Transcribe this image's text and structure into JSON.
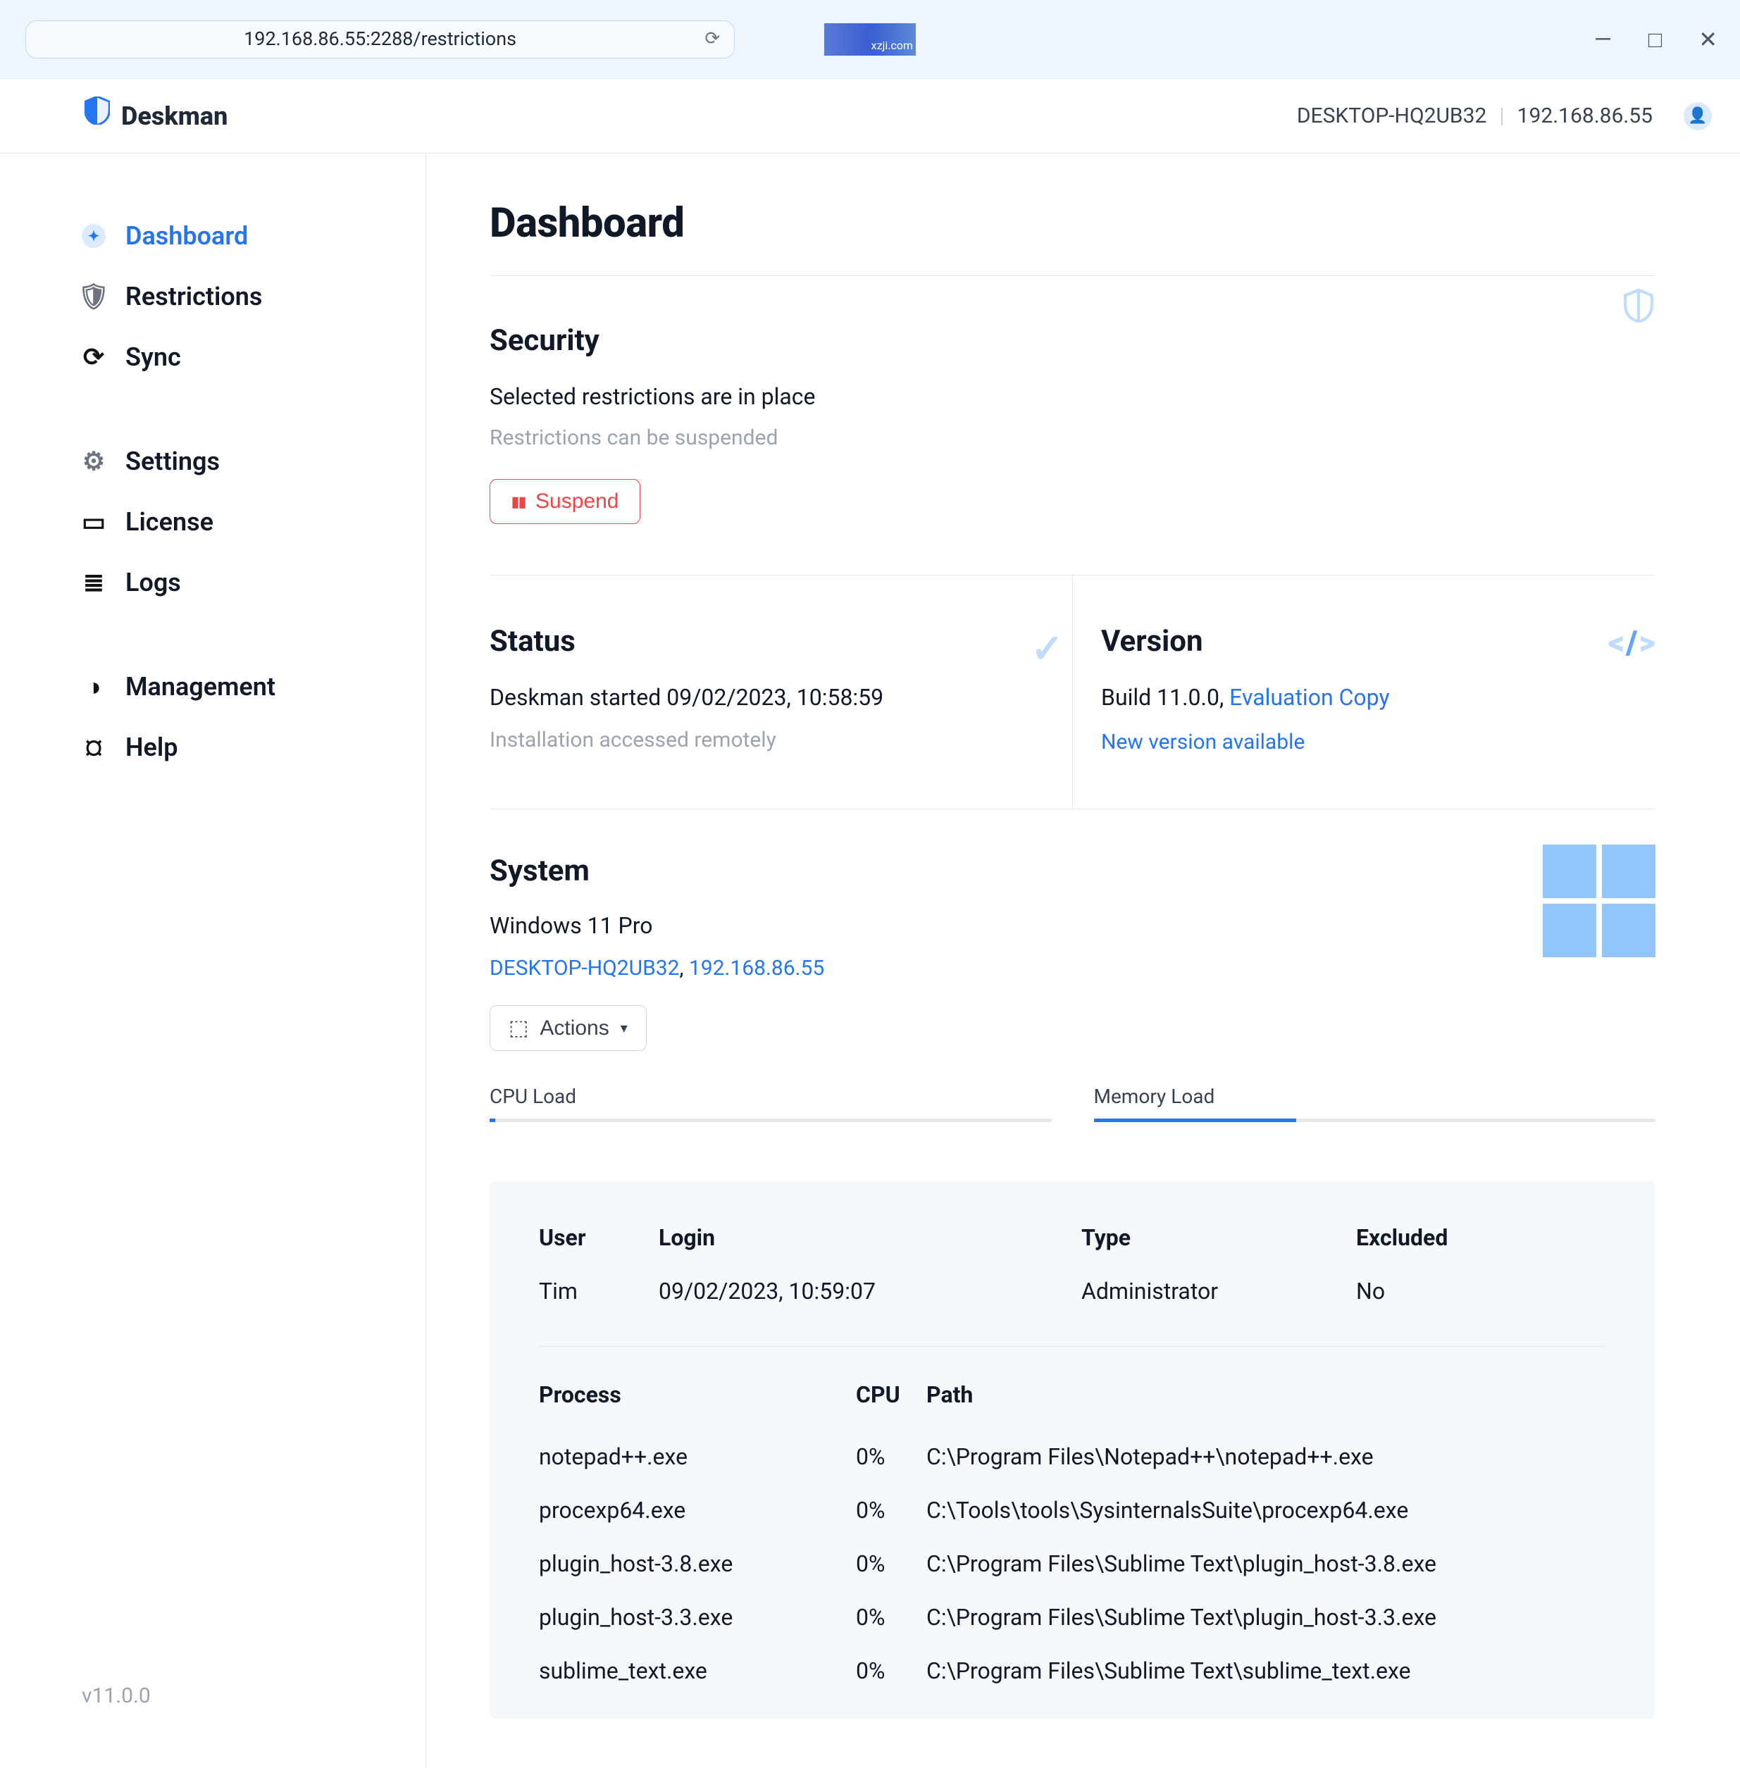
{
  "chrome": {
    "url": "192.168.86.55:2288/restrictions",
    "badge_text": "xzji.com"
  },
  "header": {
    "brand": "Deskman",
    "hostname": "DESKTOP-HQ2UB32",
    "ip": "192.168.86.55"
  },
  "sidebar": {
    "items": [
      {
        "label": "Dashboard"
      },
      {
        "label": "Restrictions"
      },
      {
        "label": "Sync"
      },
      {
        "label": "Settings"
      },
      {
        "label": "License"
      },
      {
        "label": "Logs"
      },
      {
        "label": "Management"
      },
      {
        "label": "Help"
      }
    ],
    "version": "v11.0.0"
  },
  "page": {
    "title": "Dashboard"
  },
  "security": {
    "title": "Security",
    "sub": "Selected restrictions are in place",
    "hint": "Restrictions can be suspended",
    "suspend_label": "Suspend"
  },
  "status": {
    "title": "Status",
    "sub": "Deskman started 09/02/2023, 10:58:59",
    "hint": "Installation accessed remotely"
  },
  "version": {
    "title": "Version",
    "sub_prefix": "Build 11.0.0, ",
    "eval": "Evaluation Copy",
    "update": "New version available"
  },
  "system": {
    "title": "System",
    "os": "Windows 11 Pro",
    "hostname": "DESKTOP-HQ2UB32",
    "ip": "192.168.86.55",
    "actions_label": "Actions",
    "cpu_label": "CPU Load",
    "mem_label": "Memory Load",
    "cpu_pct": 1,
    "mem_pct": 36
  },
  "user_panel": {
    "headers": {
      "user": "User",
      "login": "Login",
      "type": "Type",
      "excluded": "Excluded"
    },
    "values": {
      "user": "Tim",
      "login": "09/02/2023, 10:59:07",
      "type": "Administrator",
      "excluded": "No"
    }
  },
  "proc": {
    "headers": {
      "process": "Process",
      "cpu": "CPU",
      "path": "Path"
    },
    "rows": [
      {
        "process": "notepad++.exe",
        "cpu": "0%",
        "path": "C:\\Program Files\\Notepad++\\notepad++.exe"
      },
      {
        "process": "procexp64.exe",
        "cpu": "0%",
        "path": "C:\\Tools\\tools\\SysinternalsSuite\\procexp64.exe"
      },
      {
        "process": "plugin_host-3.8.exe",
        "cpu": "0%",
        "path": "C:\\Program Files\\Sublime Text\\plugin_host-3.8.exe"
      },
      {
        "process": "plugin_host-3.3.exe",
        "cpu": "0%",
        "path": "C:\\Program Files\\Sublime Text\\plugin_host-3.3.exe"
      },
      {
        "process": "sublime_text.exe",
        "cpu": "0%",
        "path": "C:\\Program Files\\Sublime Text\\sublime_text.exe"
      }
    ]
  }
}
